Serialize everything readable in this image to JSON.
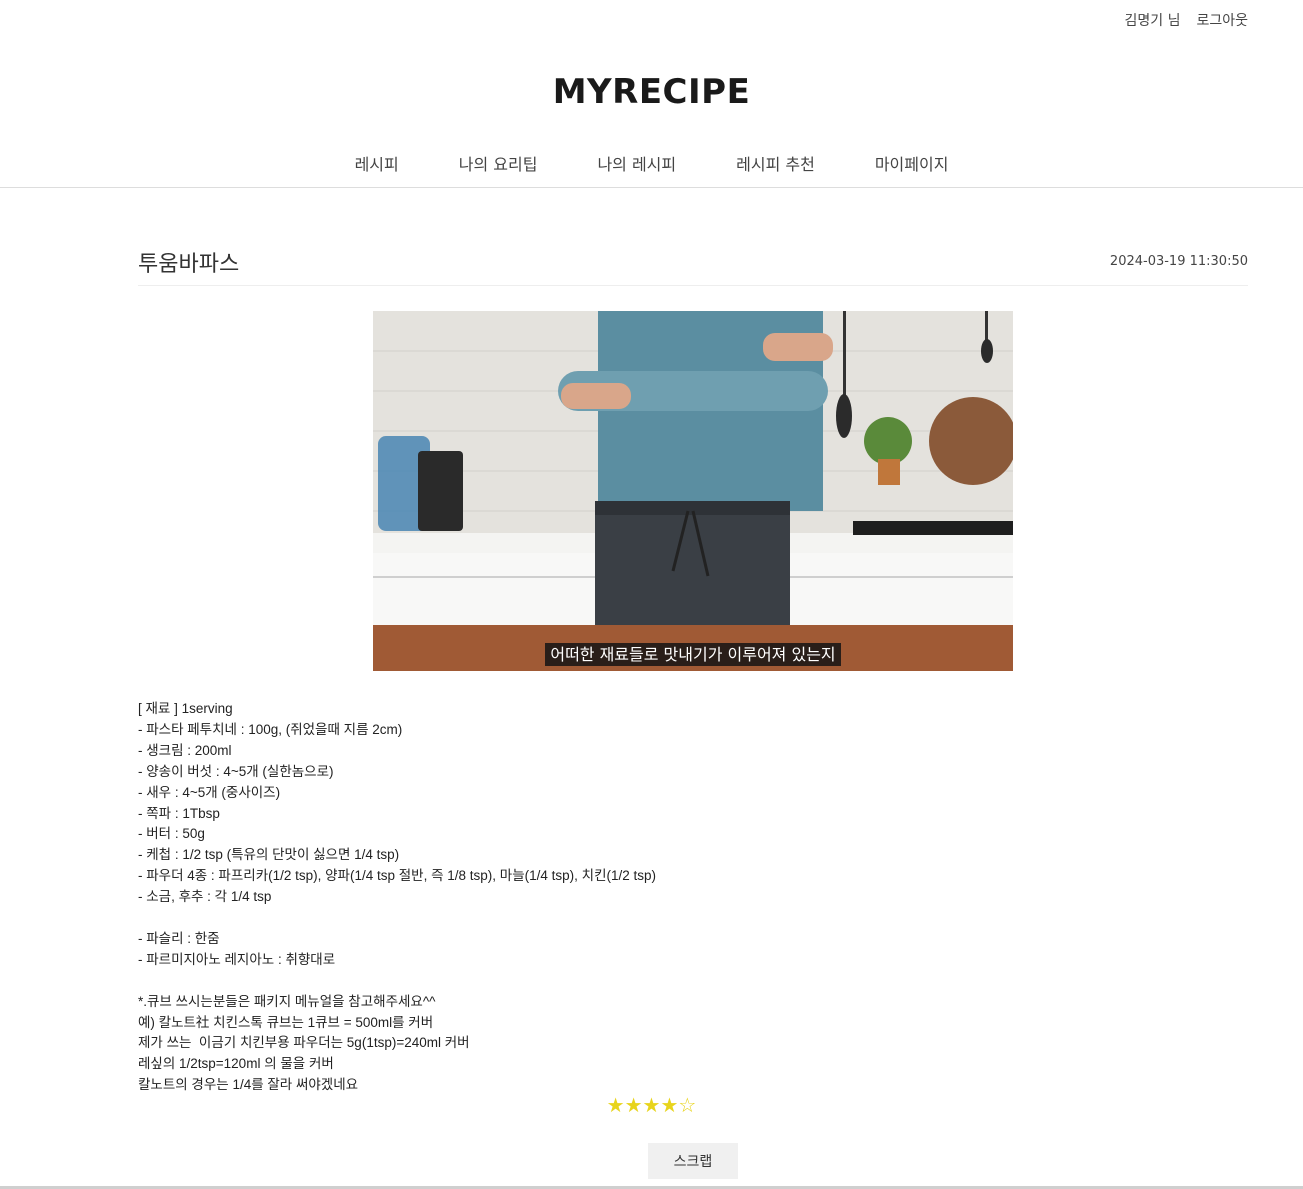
{
  "user": {
    "name": "김명기 님",
    "logout_label": "로그아웃"
  },
  "brand": "MYRECIPE",
  "nav": [
    "레시피",
    "나의 요리팁",
    "나의 레시피",
    "레시피 추천",
    "마이페이지"
  ],
  "post": {
    "title": "투움바파스",
    "date": "2024-03-19 11:30:50",
    "video_subtitle": "어떠한 재료들로 맛내기가 이루어져 있는지",
    "lines": [
      "[ 재료 ] 1serving",
      "- 파스타 페투치네 : 100g, (쥐었을때 지름 2cm)",
      "- 생크림 : 200ml",
      "- 양송이 버섯 : 4~5개 (실한놈으로)",
      "- 새우 : 4~5개 (중사이즈)",
      "- 쪽파 : 1Tbsp",
      "- 버터 : 50g",
      "- 케첩 : 1/2 tsp (특유의 단맛이 싫으면 1/4 tsp)",
      "- 파우더 4종 : 파프리카(1/2 tsp), 양파(1/4 tsp 절반, 즉 1/8 tsp), 마늘(1/4 tsp), 치킨(1/2 tsp)",
      "- 소금, 후추 : 각 1/4 tsp",
      "",
      "- 파슬리 : 한줌",
      "- 파르미지아노 레지아노 : 취향대로",
      "",
      "*.큐브 쓰시는분들은 패키지 메뉴얼을 참고해주세요^^",
      "예) 칼노트社 치킨스톡 큐브는 1큐브 = 500ml를 커버",
      "제가 쓰는  이금기 치킨부용 파우더는 5g(1tsp)=240ml 커버",
      "레싶의 1/2tsp=120ml 의 물을 커버",
      "칼노트의 경우는 1/4를 잘라 써야겠네요"
    ],
    "rating": 4,
    "rating_max": 5,
    "scrap_label": "스크랩"
  },
  "colors": {
    "star": "#e8d41c",
    "button_bg": "#f0f0f0"
  }
}
